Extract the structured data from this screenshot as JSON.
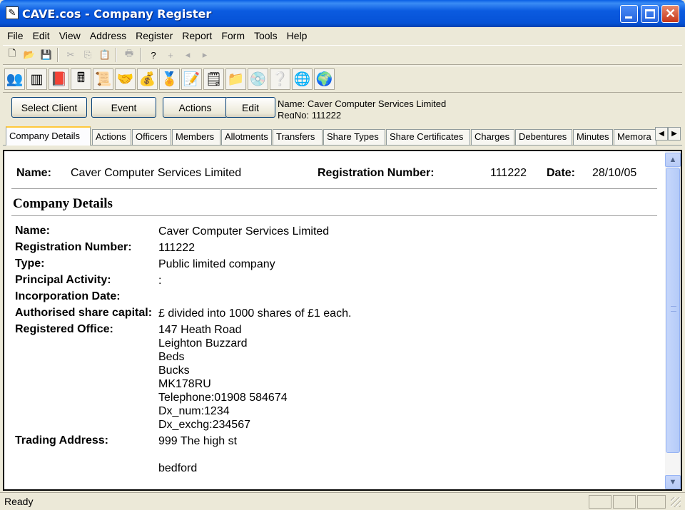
{
  "window": {
    "title": "CAVE.cos - Company Register"
  },
  "menu": [
    "File",
    "Edit",
    "View",
    "Address",
    "Register",
    "Report",
    "Form",
    "Tools",
    "Help"
  ],
  "toolbar1": [
    {
      "icon": "new-file-icon",
      "glyph": "🗋"
    },
    {
      "icon": "open-folder-icon",
      "glyph": "📂"
    },
    {
      "icon": "save-icon",
      "glyph": "💾"
    },
    {
      "icon": "cut-icon",
      "glyph": "✂"
    },
    {
      "icon": "copy-icon",
      "glyph": "⎘"
    },
    {
      "icon": "paste-icon",
      "glyph": "📋"
    },
    {
      "icon": "print-icon",
      "glyph": "🖶"
    },
    {
      "icon": "help-icon",
      "glyph": "?"
    },
    {
      "icon": "add-icon",
      "glyph": "+"
    },
    {
      "icon": "prev-icon",
      "glyph": "◂"
    },
    {
      "icon": "next-icon",
      "glyph": "▸"
    }
  ],
  "toolbar2": [
    {
      "icon": "people-icon",
      "glyph": "👥"
    },
    {
      "icon": "register-book-icon",
      "glyph": "▥"
    },
    {
      "icon": "book-icon",
      "glyph": "📕"
    },
    {
      "icon": "calculator-icon",
      "glyph": "🖩"
    },
    {
      "icon": "certificate-icon",
      "glyph": "📜"
    },
    {
      "icon": "handshake-icon",
      "glyph": "🤝"
    },
    {
      "icon": "money-bag-icon",
      "glyph": "💰"
    },
    {
      "icon": "seal-icon",
      "glyph": "🏅"
    },
    {
      "icon": "form-icon",
      "glyph": "📝"
    },
    {
      "icon": "note-icon",
      "glyph": "🗒"
    },
    {
      "icon": "folder-icon",
      "glyph": "📁"
    },
    {
      "icon": "cd-icon",
      "glyph": "💿"
    },
    {
      "icon": "question-icon",
      "glyph": "❔"
    },
    {
      "icon": "internet-explorer-icon",
      "glyph": "🌐"
    },
    {
      "icon": "globe-update-icon",
      "glyph": "🌍"
    }
  ],
  "actions": {
    "select_client": "Select Client",
    "event": "Event",
    "actions": "Actions",
    "edit": "Edit",
    "client_name": "Name: Caver  Computer Services Limited",
    "client_regno": "RegNo: 111222"
  },
  "tabs": [
    "Company Details",
    "Actions",
    "Officers",
    "Members",
    "Allotments",
    "Transfers",
    "Share Types",
    "Share Certificates",
    "Charges",
    "Debentures",
    "Minutes",
    "Memora"
  ],
  "header": {
    "name_label": "Name:",
    "name_value": "Caver Computer Services Limited",
    "reg_label": "Registration Number:",
    "reg_value": "111222",
    "date_label": "Date:",
    "date_value": "28/10/05"
  },
  "section_title": "Company Details",
  "fields": {
    "name_label": "Name:",
    "name_value": "Caver Computer Services Limited",
    "reg_label": "Registration Number:",
    "reg_value": "111222",
    "type_label": "Type:",
    "type_value": "Public limited company",
    "activity_label": "Principal Activity:",
    "activity_value": ":",
    "inc_label": "Incorporation Date:",
    "inc_value": "",
    "capital_label": "Authorised share capital:",
    "capital_value": "£ divided into 1000 shares of £1 each.",
    "office_label": "Registered Office:",
    "office_lines": [
      "147 Heath Road",
      "Leighton Buzzard",
      "Beds",
      "Bucks",
      "MK178RU",
      "Telephone:01908 584674",
      "Dx_num:1234",
      "Dx_exchg:234567"
    ],
    "trading_label": "Trading Address:",
    "trading_lines": [
      "999 The high st",
      "",
      "bedford"
    ]
  },
  "status": {
    "text": "Ready"
  }
}
